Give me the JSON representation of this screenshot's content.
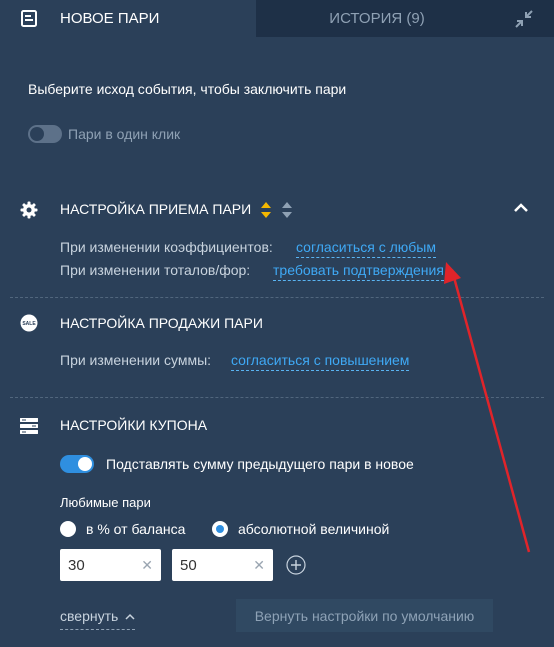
{
  "tabs": {
    "new_bet_label": "НОВОЕ ПАРИ",
    "history_label": "ИСТОРИЯ (9)"
  },
  "intro": {
    "instruction": "Выберите исход события, чтобы заключить пари",
    "one_click_label": "Пари в один клик",
    "one_click_enabled": false
  },
  "acceptance": {
    "title": "НАСТРОЙКА ПРИЕМА ПАРИ",
    "odds_change_label": "При изменении коэффициентов:",
    "odds_change_value": "согласиться с любым",
    "totals_change_label": "При изменении тоталов/фор:",
    "totals_change_value": "требовать подтверждения"
  },
  "sale": {
    "icon_text": "SALE",
    "title": "НАСТРОЙКА ПРОДАЖИ ПАРИ",
    "amount_change_label": "При изменении суммы:",
    "amount_change_value": "согласиться с повышением"
  },
  "coupon": {
    "title": "НАСТРОЙКИ КУПОНА",
    "prefill_label": "Подставлять сумму предыдущего пари в новое",
    "prefill_enabled": true,
    "favorites_title": "Любимые пари",
    "option_percent": "в % от баланса",
    "option_absolute": "абсолютной величиной",
    "selected_option": "absolute",
    "amount1": "30",
    "amount2": "50"
  },
  "footer": {
    "collapse_label": "свернуть",
    "reset_label": "Вернуть настройки по умолчанию"
  },
  "colors": {
    "background": "#2b4059",
    "tab_inactive": "#1e3047",
    "link": "#3fa9f5",
    "toggle_on": "#2f8fe0",
    "sort_arrow_active": "#f5b800",
    "annotation_arrow": "#e0242a"
  }
}
